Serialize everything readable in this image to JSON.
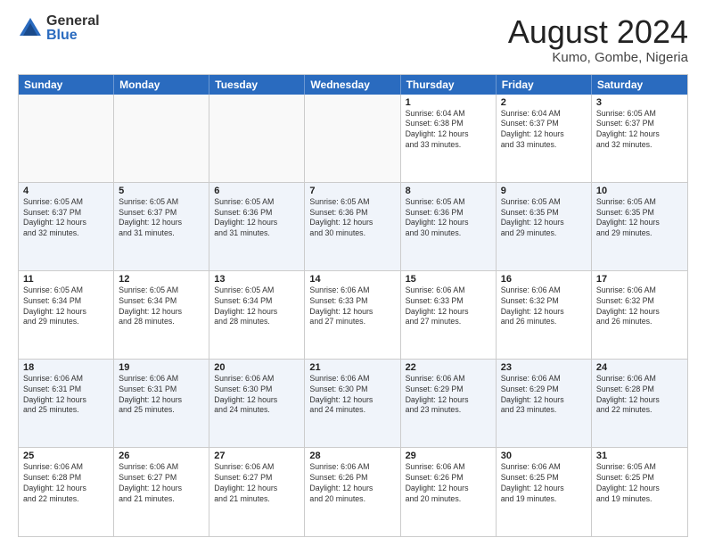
{
  "logo": {
    "general": "General",
    "blue": "Blue"
  },
  "title": "August 2024",
  "location": "Kumo, Gombe, Nigeria",
  "days": [
    "Sunday",
    "Monday",
    "Tuesday",
    "Wednesday",
    "Thursday",
    "Friday",
    "Saturday"
  ],
  "weeks": [
    [
      {
        "day": "",
        "info": ""
      },
      {
        "day": "",
        "info": ""
      },
      {
        "day": "",
        "info": ""
      },
      {
        "day": "",
        "info": ""
      },
      {
        "day": "1",
        "info": "Sunrise: 6:04 AM\nSunset: 6:38 PM\nDaylight: 12 hours\nand 33 minutes."
      },
      {
        "day": "2",
        "info": "Sunrise: 6:04 AM\nSunset: 6:37 PM\nDaylight: 12 hours\nand 33 minutes."
      },
      {
        "day": "3",
        "info": "Sunrise: 6:05 AM\nSunset: 6:37 PM\nDaylight: 12 hours\nand 32 minutes."
      }
    ],
    [
      {
        "day": "4",
        "info": "Sunrise: 6:05 AM\nSunset: 6:37 PM\nDaylight: 12 hours\nand 32 minutes."
      },
      {
        "day": "5",
        "info": "Sunrise: 6:05 AM\nSunset: 6:37 PM\nDaylight: 12 hours\nand 31 minutes."
      },
      {
        "day": "6",
        "info": "Sunrise: 6:05 AM\nSunset: 6:36 PM\nDaylight: 12 hours\nand 31 minutes."
      },
      {
        "day": "7",
        "info": "Sunrise: 6:05 AM\nSunset: 6:36 PM\nDaylight: 12 hours\nand 30 minutes."
      },
      {
        "day": "8",
        "info": "Sunrise: 6:05 AM\nSunset: 6:36 PM\nDaylight: 12 hours\nand 30 minutes."
      },
      {
        "day": "9",
        "info": "Sunrise: 6:05 AM\nSunset: 6:35 PM\nDaylight: 12 hours\nand 29 minutes."
      },
      {
        "day": "10",
        "info": "Sunrise: 6:05 AM\nSunset: 6:35 PM\nDaylight: 12 hours\nand 29 minutes."
      }
    ],
    [
      {
        "day": "11",
        "info": "Sunrise: 6:05 AM\nSunset: 6:34 PM\nDaylight: 12 hours\nand 29 minutes."
      },
      {
        "day": "12",
        "info": "Sunrise: 6:05 AM\nSunset: 6:34 PM\nDaylight: 12 hours\nand 28 minutes."
      },
      {
        "day": "13",
        "info": "Sunrise: 6:05 AM\nSunset: 6:34 PM\nDaylight: 12 hours\nand 28 minutes."
      },
      {
        "day": "14",
        "info": "Sunrise: 6:06 AM\nSunset: 6:33 PM\nDaylight: 12 hours\nand 27 minutes."
      },
      {
        "day": "15",
        "info": "Sunrise: 6:06 AM\nSunset: 6:33 PM\nDaylight: 12 hours\nand 27 minutes."
      },
      {
        "day": "16",
        "info": "Sunrise: 6:06 AM\nSunset: 6:32 PM\nDaylight: 12 hours\nand 26 minutes."
      },
      {
        "day": "17",
        "info": "Sunrise: 6:06 AM\nSunset: 6:32 PM\nDaylight: 12 hours\nand 26 minutes."
      }
    ],
    [
      {
        "day": "18",
        "info": "Sunrise: 6:06 AM\nSunset: 6:31 PM\nDaylight: 12 hours\nand 25 minutes."
      },
      {
        "day": "19",
        "info": "Sunrise: 6:06 AM\nSunset: 6:31 PM\nDaylight: 12 hours\nand 25 minutes."
      },
      {
        "day": "20",
        "info": "Sunrise: 6:06 AM\nSunset: 6:30 PM\nDaylight: 12 hours\nand 24 minutes."
      },
      {
        "day": "21",
        "info": "Sunrise: 6:06 AM\nSunset: 6:30 PM\nDaylight: 12 hours\nand 24 minutes."
      },
      {
        "day": "22",
        "info": "Sunrise: 6:06 AM\nSunset: 6:29 PM\nDaylight: 12 hours\nand 23 minutes."
      },
      {
        "day": "23",
        "info": "Sunrise: 6:06 AM\nSunset: 6:29 PM\nDaylight: 12 hours\nand 23 minutes."
      },
      {
        "day": "24",
        "info": "Sunrise: 6:06 AM\nSunset: 6:28 PM\nDaylight: 12 hours\nand 22 minutes."
      }
    ],
    [
      {
        "day": "25",
        "info": "Sunrise: 6:06 AM\nSunset: 6:28 PM\nDaylight: 12 hours\nand 22 minutes."
      },
      {
        "day": "26",
        "info": "Sunrise: 6:06 AM\nSunset: 6:27 PM\nDaylight: 12 hours\nand 21 minutes."
      },
      {
        "day": "27",
        "info": "Sunrise: 6:06 AM\nSunset: 6:27 PM\nDaylight: 12 hours\nand 21 minutes."
      },
      {
        "day": "28",
        "info": "Sunrise: 6:06 AM\nSunset: 6:26 PM\nDaylight: 12 hours\nand 20 minutes."
      },
      {
        "day": "29",
        "info": "Sunrise: 6:06 AM\nSunset: 6:26 PM\nDaylight: 12 hours\nand 20 minutes."
      },
      {
        "day": "30",
        "info": "Sunrise: 6:06 AM\nSunset: 6:25 PM\nDaylight: 12 hours\nand 19 minutes."
      },
      {
        "day": "31",
        "info": "Sunrise: 6:05 AM\nSunset: 6:25 PM\nDaylight: 12 hours\nand 19 minutes."
      }
    ]
  ]
}
